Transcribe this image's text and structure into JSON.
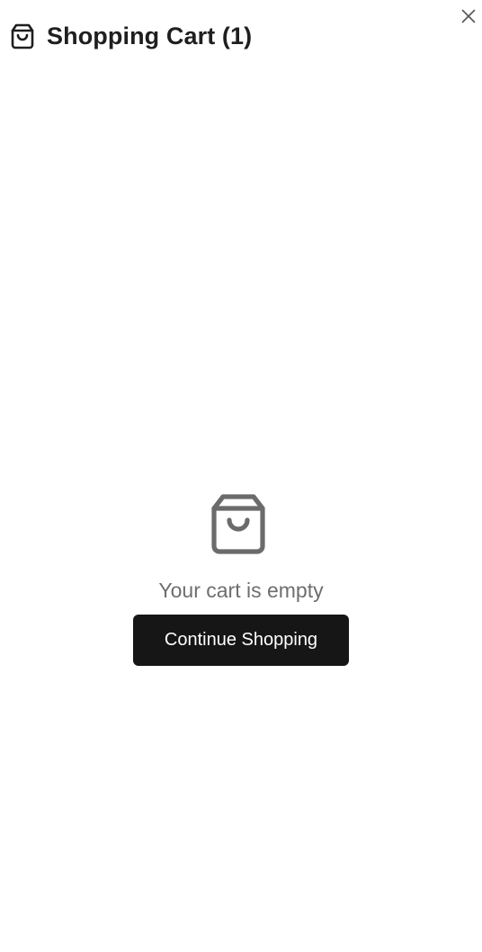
{
  "header": {
    "title": "Shopping Cart (1)",
    "icon": "shopping-bag-icon",
    "close_icon": "close-icon"
  },
  "empty_state": {
    "icon": "shopping-bag-icon",
    "message": "Your cart is empty",
    "button_label": "Continue Shopping"
  },
  "colors": {
    "background": "#ffffff",
    "title_text": "#1f1f1f",
    "muted_text": "#6e6e6e",
    "icon_gray": "#6b6b6b",
    "button_bg": "#161616",
    "button_text": "#ffffff"
  }
}
